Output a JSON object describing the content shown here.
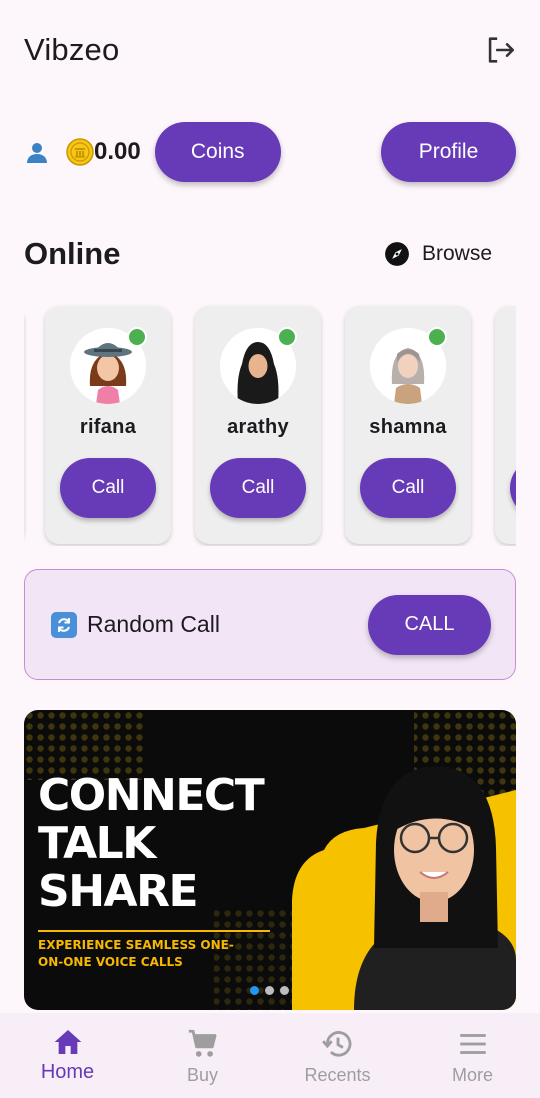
{
  "app": {
    "title": "Vibzeo"
  },
  "header": {
    "logout_icon": "logout-icon"
  },
  "balance": {
    "user_icon": "person-icon",
    "coin_icon": "coin-icon",
    "amount": "0.00",
    "coins_label": "Coins",
    "profile_label": "Profile"
  },
  "online": {
    "title": "Online",
    "browse_label": "Browse",
    "browse_icon": "compass-icon",
    "users": [
      {
        "name": "rifana",
        "call_label": "Call",
        "online": true
      },
      {
        "name": "arathy",
        "call_label": "Call",
        "online": true
      },
      {
        "name": "shamna",
        "call_label": "Call",
        "online": true
      }
    ]
  },
  "random_call": {
    "label": "Random Call",
    "icon": "shuffle-icon",
    "button_label": "CALL"
  },
  "banner": {
    "lines": [
      "CONNECT",
      "TALK",
      "SHARE"
    ],
    "subtitle_1": "EXPERIENCE SEAMLESS ONE-",
    "subtitle_2": "ON-ONE VOICE CALLS",
    "page_count": 3,
    "active_page": 0
  },
  "bottom_nav": {
    "items": [
      {
        "label": "Home",
        "icon": "home-icon",
        "active": true
      },
      {
        "label": "Buy",
        "icon": "cart-icon",
        "active": false
      },
      {
        "label": "Recents",
        "icon": "history-icon",
        "active": false
      },
      {
        "label": "More",
        "icon": "menu-icon",
        "active": false
      }
    ]
  },
  "colors": {
    "primary": "#673ab7",
    "online_dot": "#4caf50",
    "background": "#fdf7fc",
    "banner_accent": "#f6b800"
  }
}
